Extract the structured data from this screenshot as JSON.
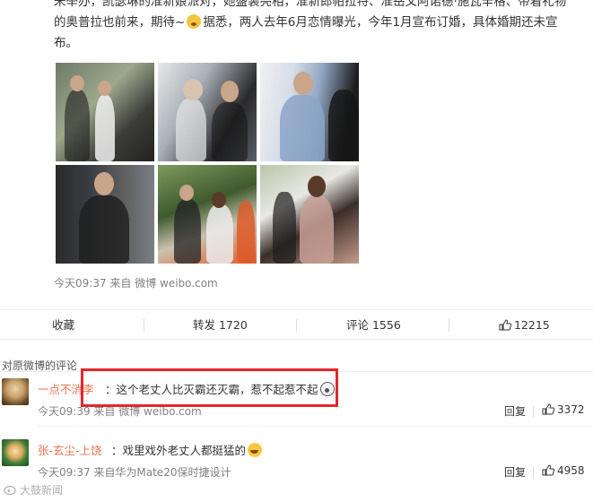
{
  "post": {
    "line1": "未举办，凯瑟琳的准新娘派对，她盛装亮相，准新郎帕拉特、准岳父阿诺德·施瓦辛格、带着礼物",
    "line2a": "的奥普拉也前来，期待~",
    "line2b": "据悉，两人去年6月恋情曝光，今年1月宣布订婚，具体婚期还未宣",
    "line3": "布。",
    "meta": "今天09:37 来自 微博 weibo.com"
  },
  "actions": {
    "collect": "收藏",
    "repost": "转发 1720",
    "comment": "评论 1556",
    "like": "12215"
  },
  "comments_section": {
    "title": "对原微博的评论"
  },
  "comments": [
    {
      "user": "一点不消李",
      "text": "：这个老丈人比灭霸还灭霸，惹不起惹不起",
      "meta": "今天09:39 来自 微博 weibo.com",
      "reply": "回复",
      "likes": "3372"
    },
    {
      "user": "张-玄尘-上饶",
      "text": "：戏里戏外老丈人都挺猛的",
      "meta": "今天09:37 来自华为Mate20保时捷设计",
      "reply": "回复",
      "likes": "4958"
    }
  ],
  "watermark": "大鼓新闻",
  "colors": {
    "username": "#eb7350",
    "highlight": "#e4262d",
    "meta": "#808080"
  }
}
